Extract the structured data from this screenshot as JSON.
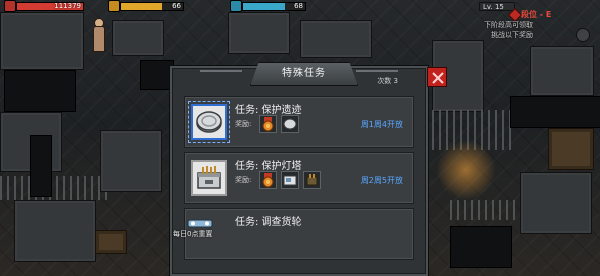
{
  "hud": {
    "health": {
      "value": "111379",
      "fill": 1.0,
      "color": "#d43b32"
    },
    "bar2": {
      "value": "66",
      "fill": 0.66,
      "color": "#e0a72a"
    },
    "bar3": {
      "value": "68",
      "fill": 0.68,
      "color": "#3aa8c8"
    },
    "level": "Lv. 15",
    "rank": "段位 - E",
    "hint_line1": "下阶段高可领取",
    "hint_line2": "挑战以下奖励"
  },
  "panel": {
    "title": "特殊任务",
    "count_label": "次数 3",
    "close_icon": "close-x-icon"
  },
  "missions": [
    {
      "title": "任务: 保护遗迹",
      "reward_label": "奖励:",
      "open_text": "周1周4开放",
      "icon": "silver-coin-icon",
      "rewards": [
        "orange-medal-icon",
        "silver-coin-icon"
      ],
      "selected": true
    },
    {
      "title": "任务: 保护灯塔",
      "reward_label": "奖励:",
      "open_text": "周2周5开放",
      "icon": "supply-crate-icon",
      "rewards": [
        "orange-medal-icon",
        "blueprint-icon",
        "ammo-box-icon"
      ],
      "selected": false
    },
    {
      "title": "任务: 调查货轮",
      "reward_label": "",
      "open_text": "",
      "icon": "",
      "rewards": [],
      "selected": false
    }
  ],
  "footer": {
    "reset_text": "每日0点重置"
  }
}
